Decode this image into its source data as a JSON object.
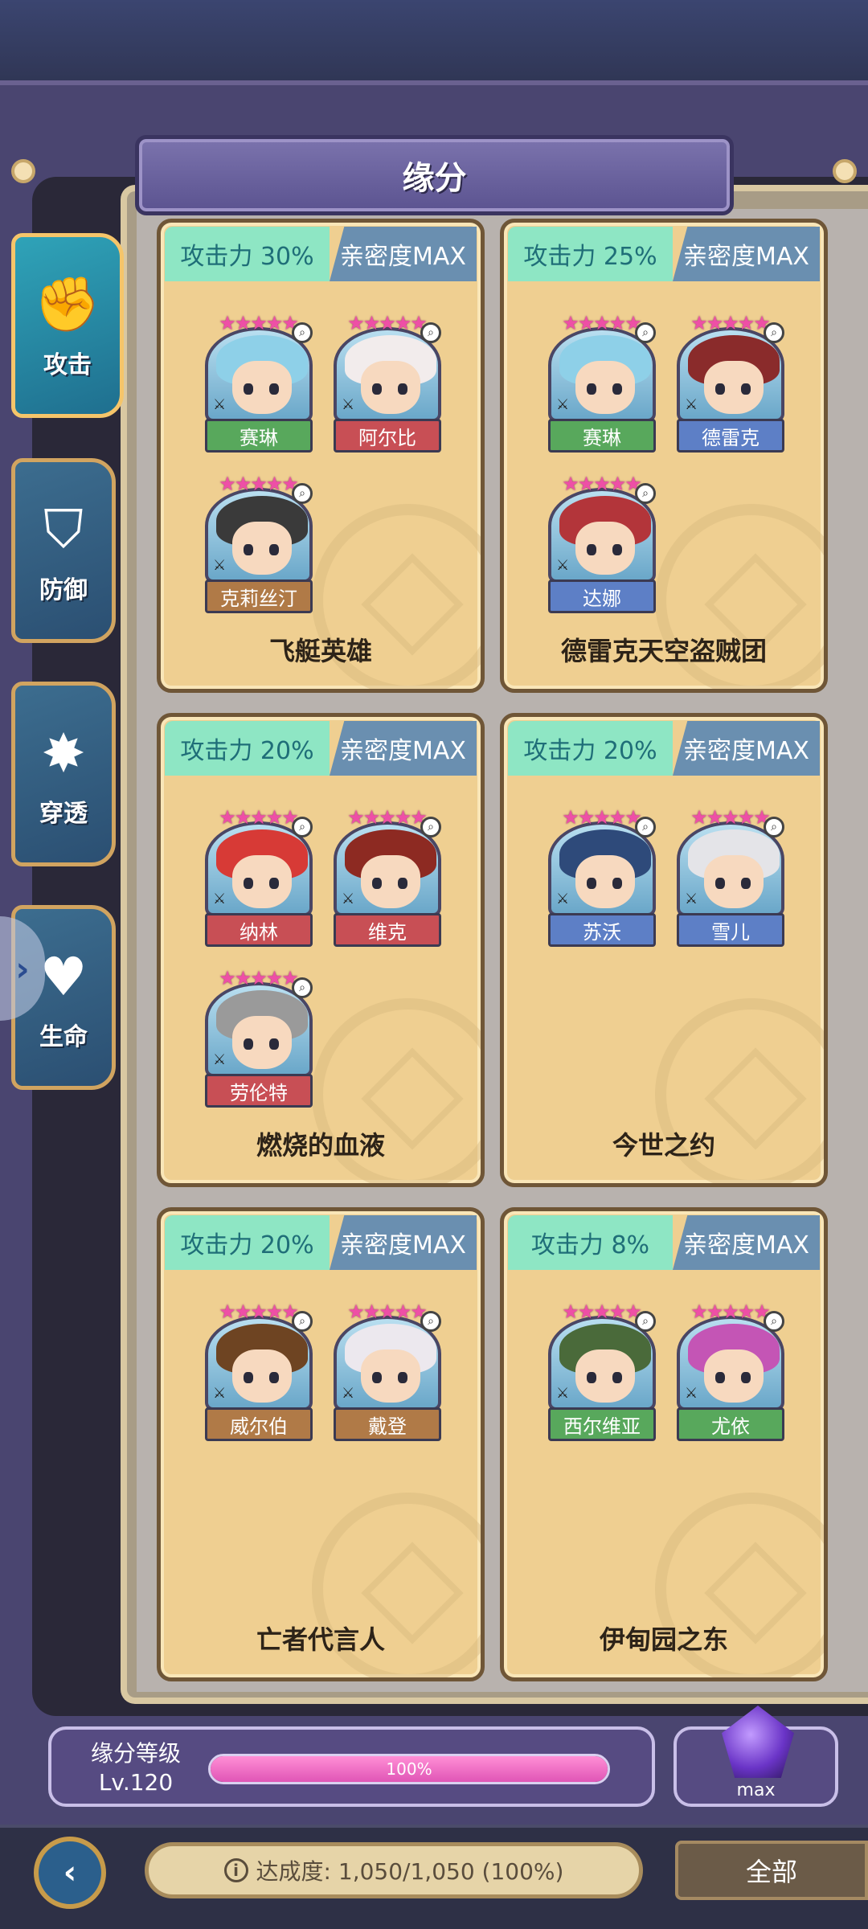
{
  "title": "缘分",
  "side_tabs": [
    {
      "label": "攻击",
      "icon": "fist-icon"
    },
    {
      "label": "防御",
      "icon": "shield-icon"
    },
    {
      "label": "穿透",
      "icon": "burst-icon"
    },
    {
      "label": "生命",
      "icon": "heart-icon"
    }
  ],
  "cards": [
    {
      "stat": "攻击力 30%",
      "affinity": "亲密度MAX",
      "name": "飞艇英雄",
      "heroes": [
        {
          "name": "赛琳",
          "color": "green",
          "hair": "#8ed0e8",
          "stars": 5
        },
        {
          "name": "阿尔比",
          "color": "red",
          "hair": "#f2ecec",
          "stars": 5
        },
        {
          "name": "克莉丝汀",
          "color": "brown",
          "hair": "#3a3a3a",
          "stars": 5
        }
      ]
    },
    {
      "stat": "攻击力 25%",
      "affinity": "亲密度MAX",
      "name": "德雷克天空盗贼团",
      "heroes": [
        {
          "name": "赛琳",
          "color": "green",
          "hair": "#8ed0e8",
          "stars": 5
        },
        {
          "name": "德雷克",
          "color": "blue",
          "hair": "#8a2b2b",
          "stars": 5
        },
        {
          "name": "达娜",
          "color": "blue",
          "hair": "#b3353a",
          "stars": 5
        }
      ]
    },
    {
      "stat": "攻击力 20%",
      "affinity": "亲密度MAX",
      "name": "燃烧的血液",
      "heroes": [
        {
          "name": "纳林",
          "color": "red",
          "hair": "#d73a36",
          "stars": 5
        },
        {
          "name": "维克",
          "color": "red",
          "hair": "#8d2a22",
          "stars": 5
        },
        {
          "name": "劳伦特",
          "color": "red",
          "hair": "#9a9a9a",
          "stars": 5
        }
      ]
    },
    {
      "stat": "攻击力 20%",
      "affinity": "亲密度MAX",
      "name": "今世之约",
      "heroes": [
        {
          "name": "苏沃",
          "color": "blue",
          "hair": "#2e4a7a",
          "stars": 5
        },
        {
          "name": "雪儿",
          "color": "blue",
          "hair": "#e4e4e8",
          "stars": 5
        }
      ]
    },
    {
      "stat": "攻击力 20%",
      "affinity": "亲密度MAX",
      "name": "亡者代言人",
      "heroes": [
        {
          "name": "威尔伯",
          "color": "brown",
          "hair": "#6e4422",
          "stars": 5
        },
        {
          "name": "戴登",
          "color": "brown",
          "hair": "#ece8ee",
          "stars": 5
        }
      ]
    },
    {
      "stat": "攻击力 8%",
      "affinity": "亲密度MAX",
      "name": "伊甸园之东",
      "heroes": [
        {
          "name": "西尔维亚",
          "color": "green",
          "hair": "#4a6a3a",
          "stars": 5
        },
        {
          "name": "尤依",
          "color": "green",
          "hair": "#c455b5",
          "stars": 5
        }
      ]
    }
  ],
  "level": {
    "title": "缘分等级",
    "value": "Lv.120",
    "progress": 1.0,
    "progress_label": "100%"
  },
  "max_label": "max",
  "footer": {
    "progress_text": "达成度: 1,050/1,050 (100%)",
    "filter_label": "全部"
  }
}
